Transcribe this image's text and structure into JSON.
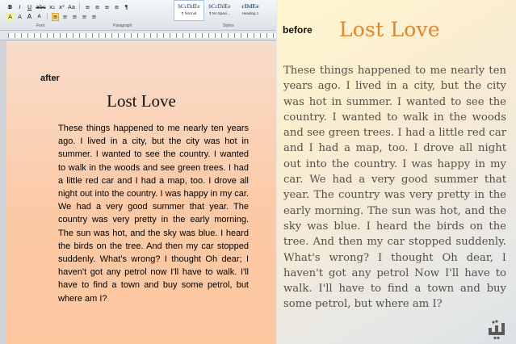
{
  "toolbar": {
    "row1": [
      "B",
      "I",
      "U",
      "abc",
      "x₂",
      "x²",
      "Aa"
    ],
    "row2": [
      "A",
      "A",
      "A",
      "A"
    ],
    "para_row1": [
      "≡",
      "≡",
      "≡",
      "≡",
      "¶"
    ],
    "para_row2": [
      "≡",
      "≡",
      "≡",
      "≡",
      "≡"
    ],
    "groups": {
      "font": "Font",
      "paragraph": "Paragraph",
      "styles": "Styles"
    }
  },
  "styles": [
    {
      "preview": "bCcDdEe",
      "name": "¶ Normal",
      "active": true
    },
    {
      "preview": "bCcDdEe",
      "name": "¶ No Spaci...",
      "active": false
    },
    {
      "preview": "cDdEe",
      "name": "Heading 1",
      "active": false
    }
  ],
  "after_doc": {
    "label": "after",
    "title": "Lost Love",
    "body": "These things happened to me nearly ten years ago. I lived in a city, but the city was hot in summer. I wanted to see the country. I wanted to walk in the woods and see green trees. I had a little red car and I had a map, too. I drove all night out into the country. I was happy in my car. We had a very good summer that year. The country was very pretty in the early morning. The sun was hot, and the sky was blue. I heard the birds on the tree. And then my car stopped suddenly. What's wrong? I thought Oh dear; I haven't got any petrol now I'll have to walk. I'll have to find a town and buy some petrol, but where am I?"
  },
  "before_doc": {
    "label": "before",
    "title": "Lost Love",
    "body": "These things happened to me nearly ten years ago. I lived in a city, but the city was hot in summer. I wanted to see the country. I wanted to walk in the woods and see green trees. I had a little red car and I had a map, too. I drove all night out into the country. I was happy in my car. We had a very good summer that year. The country was very pretty in the early morning. The sun was hot, and the sky was blue. I heard the birds on the tree. And then my car stopped suddenly. What's wrong? I thought Oh dear, I haven't got any petrol Now I'll have to walk. I'll have to find a town and buy some petrol, but where am I?"
  },
  "colors": {
    "before_title": "#e0862c",
    "page_tint": "#fcc9a6"
  },
  "icons": {
    "watermark": "site-logo-icon"
  }
}
